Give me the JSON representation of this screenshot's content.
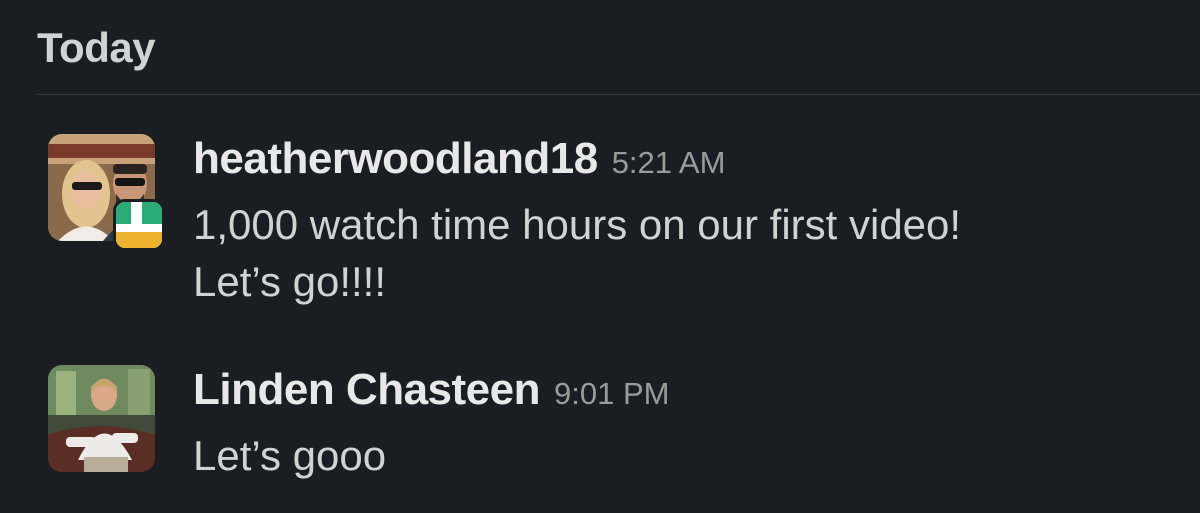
{
  "day_header": "Today",
  "messages": [
    {
      "username": "heatherwoodland18",
      "timestamp": "5:21 AM",
      "text_lines": [
        "1,000 watch time hours on our first video!",
        "Let’s go!!!!"
      ],
      "avatar_icon": "couple-photo-avatar",
      "badge_icon": "app-badge-icon",
      "badge_colors": [
        "#2bac76",
        "#ffffff",
        "#ecb22e"
      ]
    },
    {
      "username": "Linden Chasteen",
      "timestamp": "9:01 PM",
      "text_lines": [
        "Let’s gooo"
      ],
      "avatar_icon": "person-photo-avatar"
    }
  ],
  "colors": {
    "background": "#1a1d21",
    "text": "#d1d2d3",
    "username": "#e8e8e8",
    "timestamp": "#9a9b9d",
    "divider": "#35373b"
  }
}
